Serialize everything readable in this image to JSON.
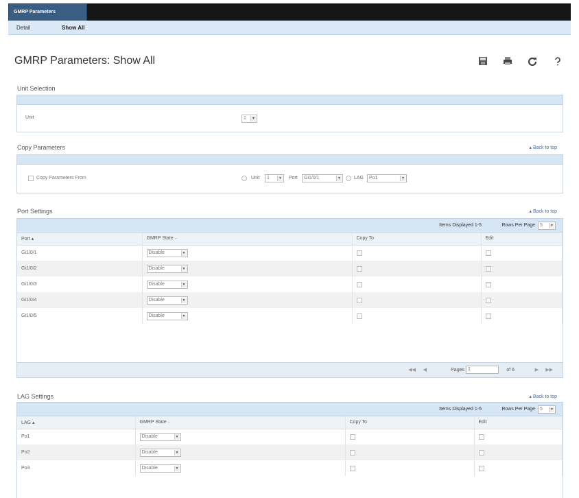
{
  "tabs": {
    "active_tab": "GMRP Parameters"
  },
  "subnav": {
    "detail": "Detail",
    "show_all": "Show All"
  },
  "page": {
    "title": "GMRP Parameters: Show All"
  },
  "toolbar": {
    "icons": [
      "save-icon",
      "print-icon",
      "refresh-icon",
      "help-icon"
    ]
  },
  "unit_selection": {
    "label": "Unit Selection",
    "unit_label": "Unit",
    "unit_value": "1"
  },
  "copy_parameters": {
    "label": "Copy Parameters",
    "back_to_top": "Back to top",
    "copy_from_label": "Copy Parameters From",
    "unit_label": "Unit",
    "unit_value": "1",
    "port_label": "Port",
    "port_value": "Gi1/0/1",
    "lag_label": "LAG",
    "lag_value": "Po1"
  },
  "port_settings": {
    "label": "Port Settings",
    "back_to_top": "Back to top",
    "items_displayed": "Items Displayed 1-5",
    "rows_per_page_label": "Rows Per Page",
    "rows_per_page_value": "5",
    "columns": [
      "Port",
      "GMRP State",
      "Copy To",
      "Edit"
    ],
    "rows": [
      {
        "port": "Gi1/0/1",
        "state": "Disable"
      },
      {
        "port": "Gi1/0/2",
        "state": "Disable"
      },
      {
        "port": "Gi1/0/3",
        "state": "Disable"
      },
      {
        "port": "Gi1/0/4",
        "state": "Disable"
      },
      {
        "port": "Gi1/0/5",
        "state": "Disable"
      }
    ],
    "pages_label": "Pages",
    "pages_value": "1",
    "of_label": "of 6"
  },
  "lag_settings": {
    "label": "LAG Settings",
    "back_to_top": "Back to top",
    "items_displayed": "Items Displayed 1-5",
    "rows_per_page_label": "Rows Per Page",
    "rows_per_page_value": "5",
    "columns": [
      "LAG",
      "GMRP State",
      "Copy To",
      "Edit"
    ],
    "rows": [
      {
        "lag": "Po1",
        "state": "Disable"
      },
      {
        "lag": "Po2",
        "state": "Disable"
      },
      {
        "lag": "Po3",
        "state": "Disable"
      }
    ]
  }
}
